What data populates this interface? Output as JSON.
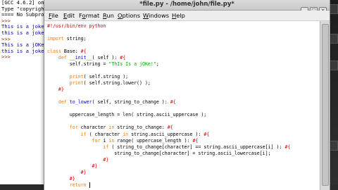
{
  "shell": {
    "lines": [
      {
        "text": "[GCC 4.6.2] on",
        "kind": "plain"
      },
      {
        "text": "Type \"copyrigh",
        "kind": "plain"
      },
      {
        "text": "==== No Subproc",
        "kind": "plain"
      },
      {
        "text": ">>> ",
        "kind": "prompt"
      },
      {
        "text": "This is a joke",
        "kind": "out"
      },
      {
        "text": "this is a joke",
        "kind": "out"
      },
      {
        "text": ">>> ",
        "kind": "prompt"
      },
      {
        "text": "This is a jOKe",
        "kind": "out"
      },
      {
        "text": "this is a joke",
        "kind": "out"
      },
      {
        "text": ">>> ",
        "kind": "prompt"
      }
    ]
  },
  "editor": {
    "title": "*file.py - /home/john/file.py*",
    "controls": {
      "minimize": "–",
      "maximize": "□",
      "close": "✕"
    },
    "menu": [
      {
        "label": "File",
        "key": "F",
        "rest": "ile"
      },
      {
        "label": "Edit",
        "key": "E",
        "rest": "dit"
      },
      {
        "label": "Format",
        "key": "o",
        "pre": "F",
        "rest": "rmat"
      },
      {
        "label": "Run",
        "key": "R",
        "rest": "un"
      },
      {
        "label": "Options",
        "key": "O",
        "rest": "ptions"
      },
      {
        "label": "Windows",
        "key": "W",
        "rest": "indows"
      },
      {
        "label": "Help",
        "key": "H",
        "rest": "elp"
      }
    ],
    "code_lines": [
      [
        [
          "cm",
          "#!/usr/bin/env python"
        ]
      ],
      [],
      [
        [
          "kw",
          "import"
        ],
        [
          "tx",
          " string;"
        ]
      ],
      [],
      [
        [
          "kw",
          "class"
        ],
        [
          "tx",
          " Base: "
        ],
        [
          "cm",
          "#{"
        ]
      ],
      [
        [
          "tx",
          "    "
        ],
        [
          "kw",
          "def"
        ],
        [
          "tx",
          " "
        ],
        [
          "df",
          "__init__"
        ],
        [
          "tx",
          "( self ): "
        ],
        [
          "cm",
          "#{"
        ]
      ],
      [
        [
          "tx",
          "        self.string = "
        ],
        [
          "st",
          "\"ThIs Is a jOKe!\""
        ],
        [
          "tx",
          ";"
        ]
      ],
      [],
      [
        [
          "tx",
          "        "
        ],
        [
          "kw",
          "print"
        ],
        [
          "tx",
          "( self.string );"
        ]
      ],
      [
        [
          "tx",
          "        "
        ],
        [
          "kw",
          "print"
        ],
        [
          "tx",
          "( self.string.lower() );"
        ]
      ],
      [
        [
          "tx",
          "    "
        ],
        [
          "cm",
          "#}"
        ]
      ],
      [],
      [
        [
          "tx",
          "    "
        ],
        [
          "kw",
          "def"
        ],
        [
          "tx",
          " "
        ],
        [
          "df",
          "to_lower"
        ],
        [
          "tx",
          "( self, string_to_change ): "
        ],
        [
          "cm",
          "#{"
        ]
      ],
      [],
      [
        [
          "tx",
          "        uppercase_length = len( string.ascii_uppercase );"
        ]
      ],
      [],
      [
        [
          "tx",
          "        "
        ],
        [
          "kw",
          "for"
        ],
        [
          "tx",
          " character "
        ],
        [
          "kw",
          "in"
        ],
        [
          "tx",
          " string_to_change: "
        ],
        [
          "cm",
          "#{"
        ]
      ],
      [
        [
          "tx",
          "            "
        ],
        [
          "kw",
          "if"
        ],
        [
          "tx",
          " ( character "
        ],
        [
          "kw",
          "in"
        ],
        [
          "tx",
          " string.ascii_uppercase ): "
        ],
        [
          "cm",
          "#{"
        ]
      ],
      [
        [
          "tx",
          "                "
        ],
        [
          "kw",
          "for"
        ],
        [
          "tx",
          " i "
        ],
        [
          "kw",
          "in"
        ],
        [
          "tx",
          " range( uppercase_length ): "
        ],
        [
          "cm",
          "#{"
        ]
      ],
      [
        [
          "tx",
          "                    "
        ],
        [
          "kw",
          "if"
        ],
        [
          "tx",
          " ( string_to_change[character] == string.ascii_uppercase[i] ): "
        ],
        [
          "cm",
          "#{"
        ]
      ],
      [
        [
          "tx",
          "                        string_to_change[character] = string.ascii_lowercase[i];"
        ]
      ],
      [
        [
          "tx",
          "                    "
        ],
        [
          "cm",
          "#}"
        ]
      ],
      [
        [
          "tx",
          "                "
        ],
        [
          "cm",
          "#}"
        ]
      ],
      [
        [
          "tx",
          "            "
        ],
        [
          "cm",
          "#}"
        ]
      ],
      [
        [
          "tx",
          "        "
        ],
        [
          "cm",
          "#}"
        ]
      ],
      [
        [
          "tx",
          "        "
        ],
        [
          "kw",
          "return"
        ],
        [
          "tx",
          " "
        ]
      ]
    ]
  }
}
